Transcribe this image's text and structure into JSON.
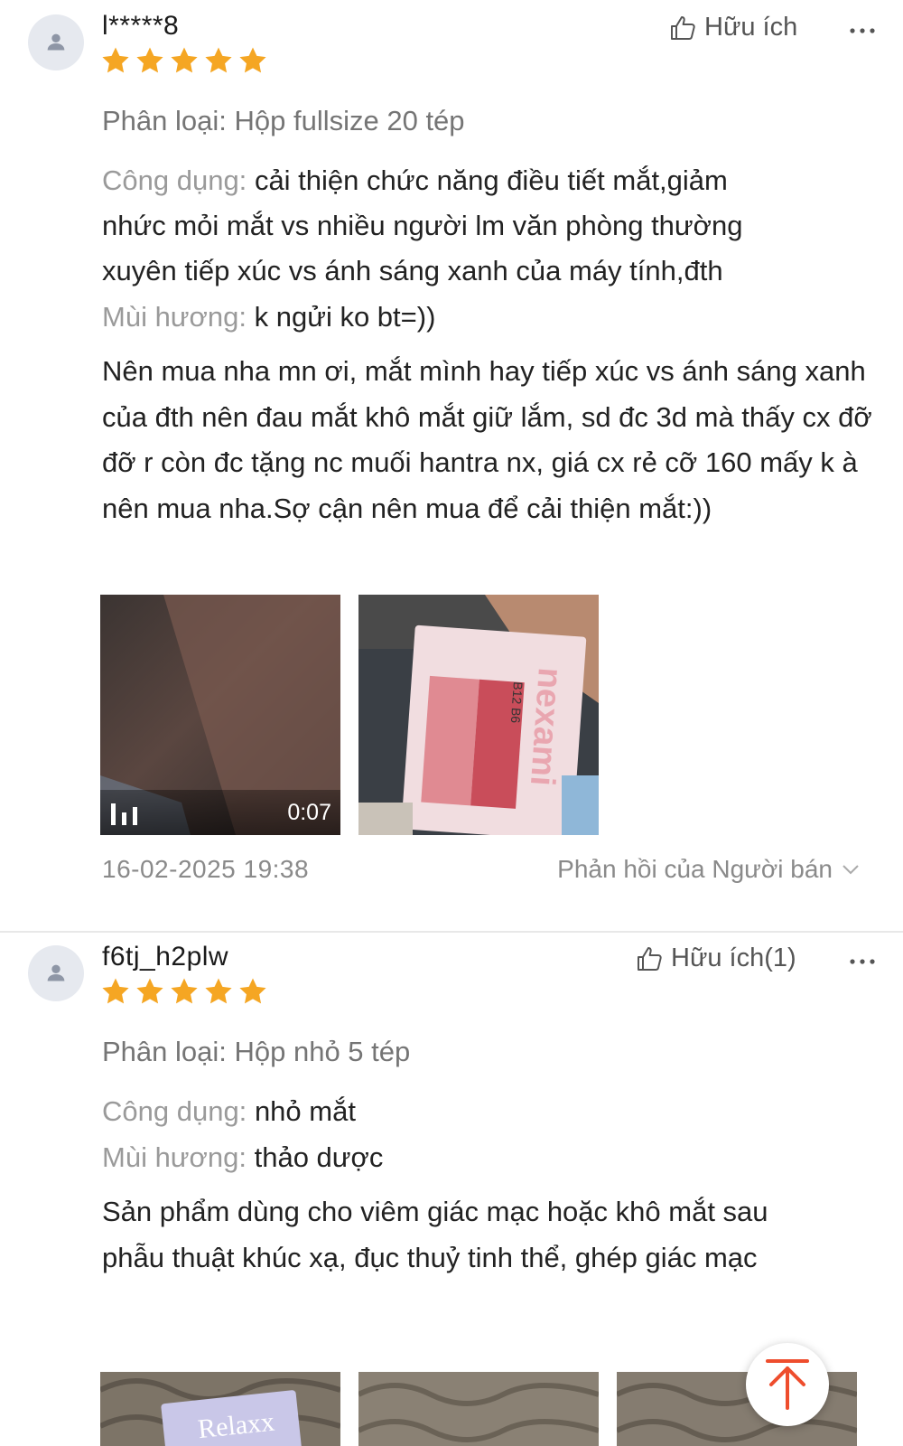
{
  "colors": {
    "star": "#f5a623",
    "accent": "#ee4d2d",
    "muted": "#8a8a8a"
  },
  "reviews": [
    {
      "username": "l*****8",
      "rating": 5,
      "helpful_label": "Hữu ích",
      "variation": "Phân loại: Hộp fullsize 20 tép",
      "attr_use_key": "Công dụng:",
      "attr_use_val": "cải thiện chức năng điều tiết mắt,giảm",
      "attr_use_line2": "nhức mỏi mắt vs nhiều người lm văn phòng thường",
      "attr_use_line3": "xuyên tiếp xúc vs ánh sáng xanh của máy tính,đth",
      "attr_scent_key": "Mùi hương:",
      "attr_scent_val": "k ngửi ko bt=))",
      "body": "Nên mua nha mn ơi, mắt mình hay tiếp xúc vs ánh sáng xanh của đth nên đau mắt khô mắt giữ lắm, sd đc 3d mà thấy cx đỡ đỡ r còn đc tặng nc muối hantra nx, giá cx rẻ cỡ 160 mấy k à nên mua nha.Sợ cận nên mua để cải thiện mắt:))",
      "video_duration": "0:07",
      "box_brand": "nexami",
      "box_vitamins": "B12 B6",
      "date": "16-02-2025 19:38",
      "seller_reply_label": "Phản hồi của Người bán"
    },
    {
      "username": "f6tj_h2plw",
      "rating": 5,
      "helpful_label": "Hữu ích(1)",
      "variation": "Phân loại: Hộp nhỏ 5 tép",
      "attr_use_key": "Công dụng:",
      "attr_use_val": "nhỏ mắt",
      "attr_scent_key": "Mùi hương:",
      "attr_scent_val": "thảo dược",
      "body": "Sản phẩm dùng cho viêm giác mạc hoặc khô mắt sau phẫu thuật khúc xạ, đục thuỷ tinh thể, ghép giác mạc",
      "image_text": "Relaxx"
    }
  ]
}
